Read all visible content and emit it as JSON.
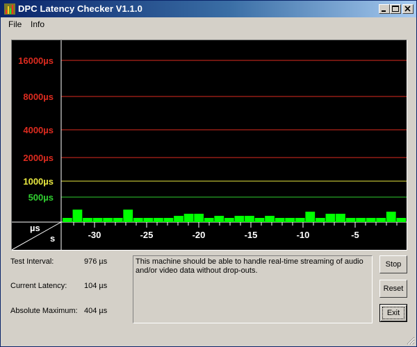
{
  "window": {
    "title": "DPC Latency Checker V1.1.0",
    "controls": {
      "minimize": "minimize",
      "maximize": "maximize",
      "close": "close"
    }
  },
  "menu": [
    {
      "label": "File"
    },
    {
      "label": "Info"
    }
  ],
  "graph": {
    "y_labels": [
      {
        "text": "16000µs",
        "color": "#dd2b1f",
        "value": 16000
      },
      {
        "text": "8000µs",
        "color": "#dd2b1f",
        "value": 8000
      },
      {
        "text": "4000µs",
        "color": "#dd2b1f",
        "value": 4000
      },
      {
        "text": "2000µs",
        "color": "#dd2b1f",
        "value": 2000
      },
      {
        "text": "1000µs",
        "color": "#e8e840",
        "value": 1000
      },
      {
        "text": "500µs",
        "color": "#30d030",
        "value": 500
      }
    ],
    "corner_y_unit": "µs",
    "corner_x_unit": "s",
    "x_labels": [
      "-30",
      "-25",
      "-20",
      "-15",
      "-10",
      "-5"
    ],
    "bar_color": "#00ff00",
    "bar_levels": [
      0.33,
      1,
      0.33,
      0.33,
      0.33,
      0.33,
      1,
      0.33,
      0.33,
      0.33,
      0.33,
      0.5,
      0.67,
      0.67,
      0.33,
      0.5,
      0.33,
      0.5,
      0.5,
      0.33,
      0.5,
      0.33,
      0.33,
      0.33,
      0.83,
      0.33,
      0.67,
      0.67,
      0.33,
      0.33,
      0.33,
      0.33,
      0.83,
      0.33
    ]
  },
  "stats": {
    "test_interval_label": "Test Interval:",
    "test_interval_value": "976 µs",
    "current_latency_label": "Current Latency:",
    "current_latency_value": "104 µs",
    "absolute_maximum_label": "Absolute Maximum:",
    "absolute_maximum_value": "404 µs"
  },
  "message": "This machine should be able to handle real-time streaming of audio and/or video data without drop-outs.",
  "buttons": {
    "stop": "Stop",
    "reset": "Reset",
    "exit": "Exit"
  }
}
